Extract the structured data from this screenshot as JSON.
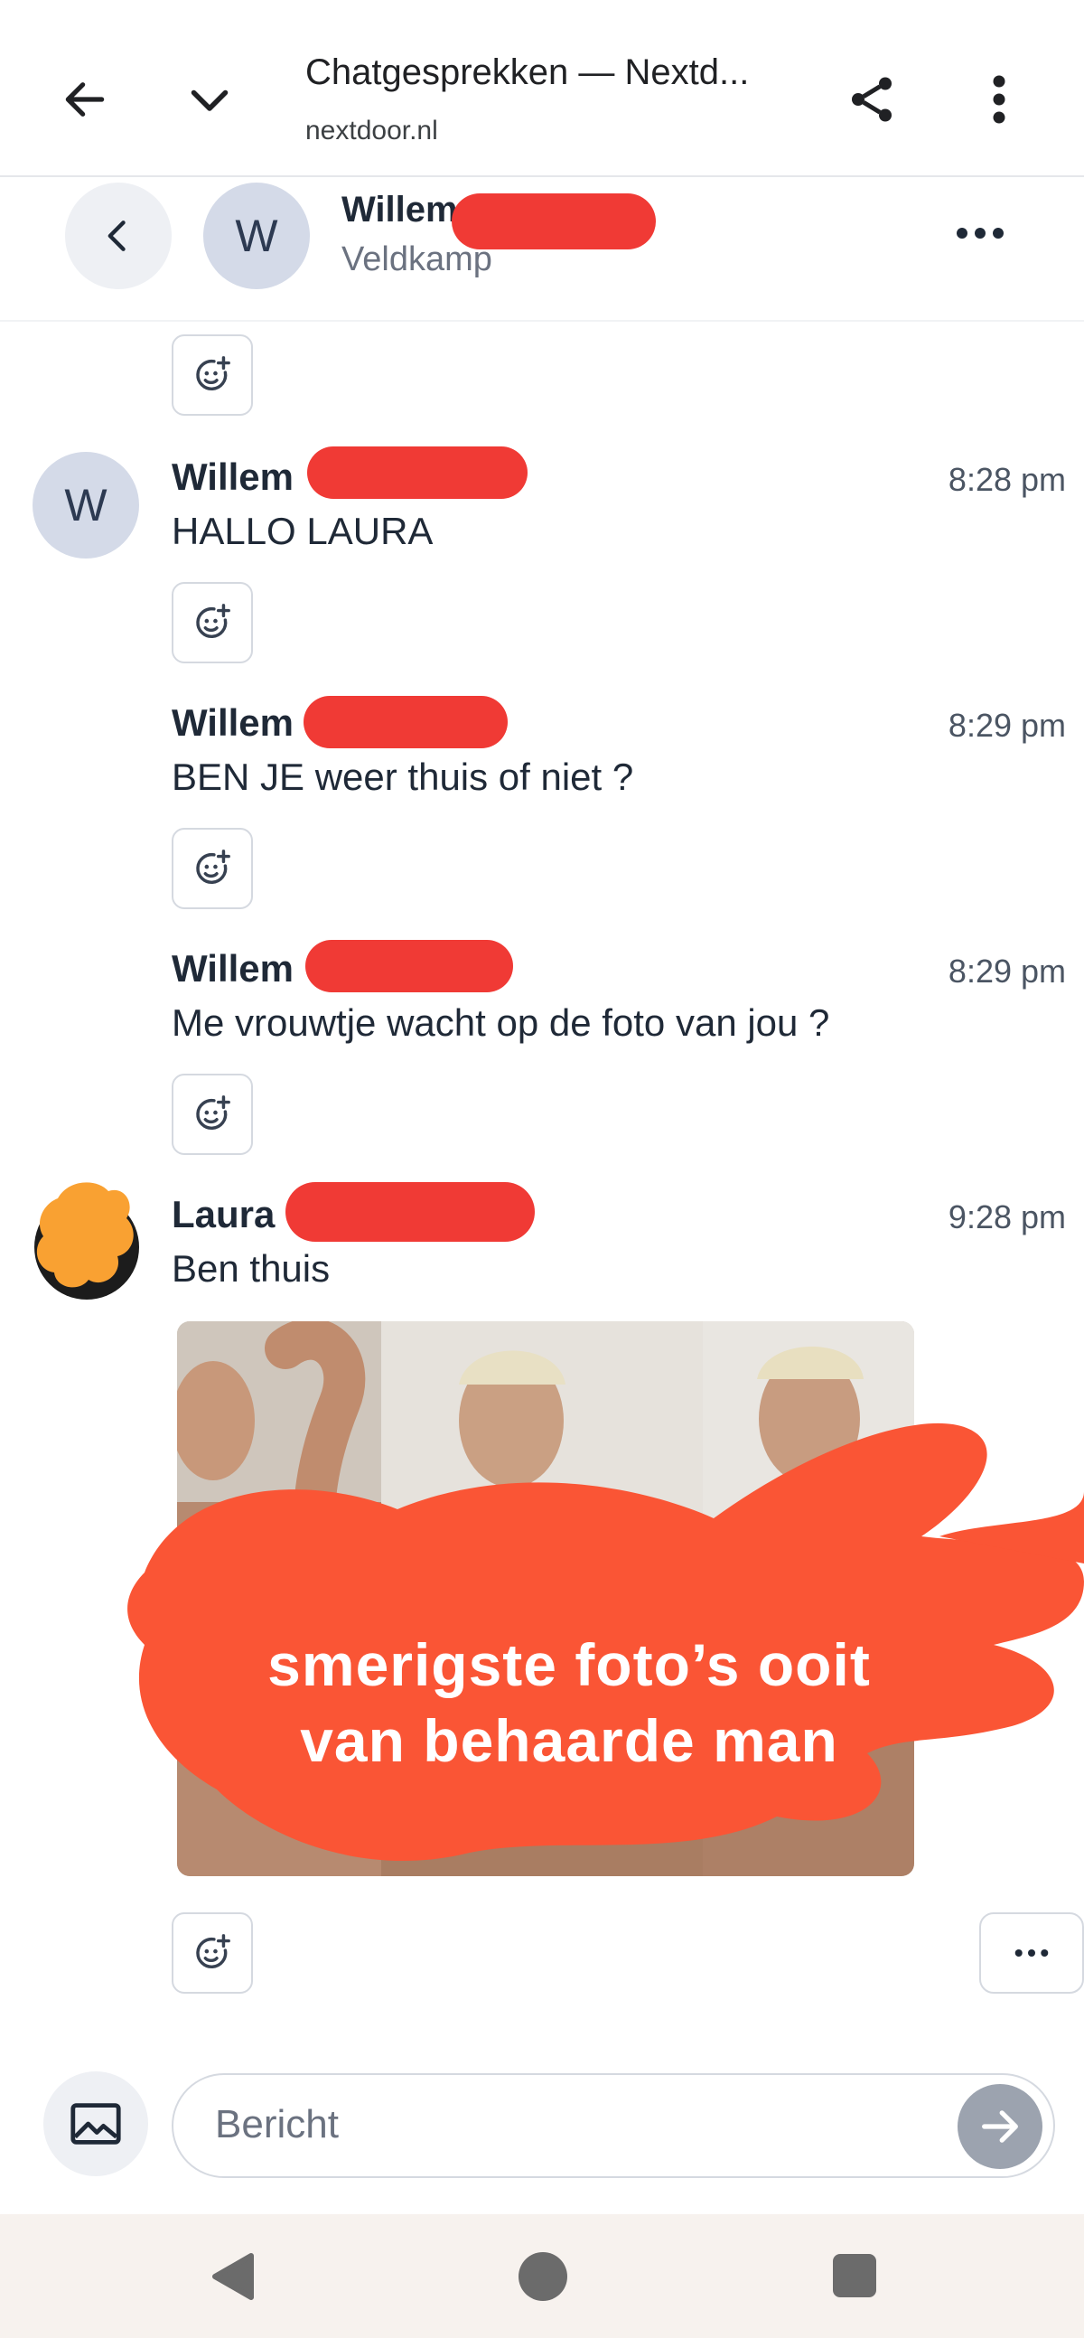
{
  "browser": {
    "title": "Chatgesprekken — Nextd...",
    "url": "nextdoor.nl",
    "icons": [
      "back-arrow-icon",
      "chevron-down-icon",
      "share-icon",
      "overflow-menu-icon"
    ]
  },
  "conversation": {
    "contact_initial": "W",
    "contact_name": "Willem",
    "contact_location": "Veldkamp"
  },
  "messages": [
    {
      "sender": "Willem",
      "avatar_initial": "W",
      "time": "8:28 pm",
      "text": "HALLO LAURA"
    },
    {
      "sender": "Willem",
      "time": "8:29 pm",
      "text": "BEN JE weer thuis of niet ?"
    },
    {
      "sender": "Willem",
      "time": "8:29 pm",
      "text": "Me vrouwtje wacht op de foto van jou ?"
    },
    {
      "sender": "Laura",
      "time": "9:28 pm",
      "text": "Ben thuis"
    }
  ],
  "attachment": {
    "overlay_text_line1": "smerigste foto’s ooit",
    "overlay_text_line2": "van behaarde man"
  },
  "composer": {
    "placeholder": "Bericht"
  },
  "colors": {
    "redaction": "#f03a35",
    "censor_overlay": "#fa5535",
    "send_button": "#9ca3af",
    "avatar_bg": "#d4dae8"
  }
}
